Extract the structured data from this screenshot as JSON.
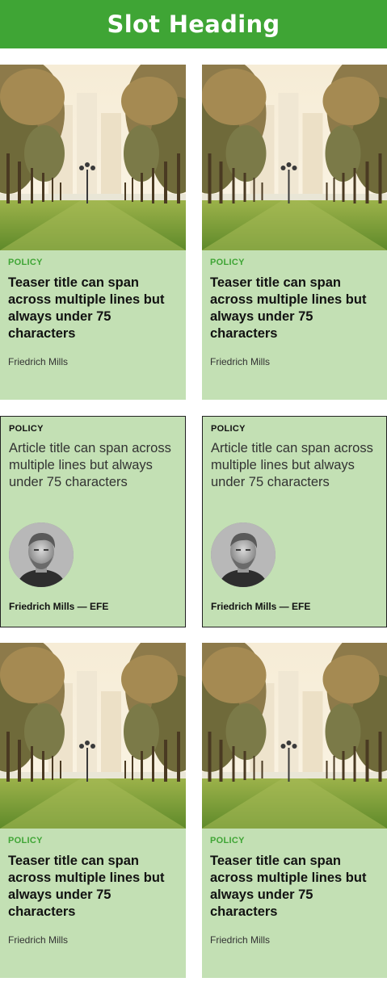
{
  "slot": {
    "heading": "Slot Heading"
  },
  "teasers": [
    {
      "category": "POLICY",
      "title": "Teaser title can span across multiple lines but always under 75 characters",
      "author": "Friedrich Mills"
    },
    {
      "category": "POLICY",
      "title": "Teaser title can span across multiple lines but always under 75 characters",
      "author": "Friedrich Mills"
    },
    {
      "category": "POLICY",
      "title": "Teaser title can span across multiple lines but always under 75 characters",
      "author": "Friedrich Mills"
    },
    {
      "category": "POLICY",
      "title": "Teaser title can span across multiple lines but always under 75 characters",
      "author": "Friedrich Mills"
    }
  ],
  "articles": [
    {
      "category": "POLICY",
      "title": "Article title can span across multiple lines but always under 75 characters",
      "byline": "Friedrich Mills — EFE"
    },
    {
      "category": "POLICY",
      "title": "Article title can span across multiple lines but always under 75 characters",
      "byline": "Friedrich Mills — EFE"
    }
  ],
  "colors": {
    "brand_green": "#3fa535",
    "card_background": "#c3e0b4",
    "heading_text": "#ffffff"
  },
  "icons": {
    "teaser_image": "park-palm-avenue-photo",
    "author_avatar": "author-portrait-photo"
  }
}
